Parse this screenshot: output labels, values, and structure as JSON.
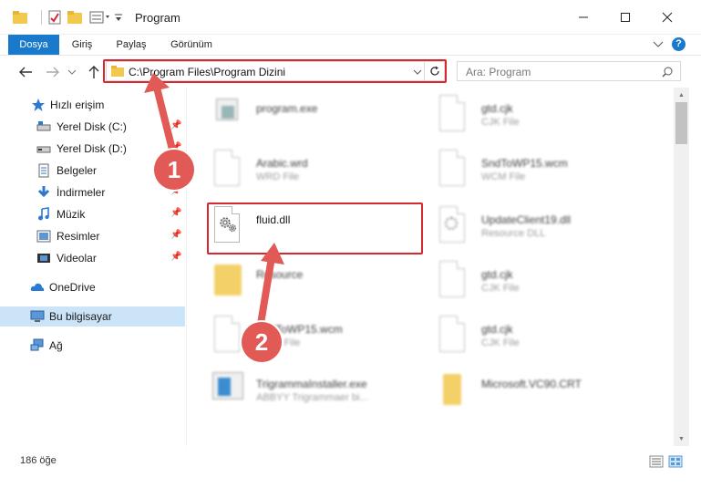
{
  "window": {
    "title": "Program",
    "minimize": "—",
    "maximize": "☐",
    "close": "✕"
  },
  "ribbon": {
    "tabs": [
      "Dosya",
      "Giriş",
      "Paylaş",
      "Görünüm"
    ],
    "help": "?"
  },
  "address": {
    "path": "C:\\Program Files\\Program Dizini",
    "search_placeholder": "Ara: Program"
  },
  "sidebar": {
    "items": [
      {
        "label": "Hızlı erişim",
        "pinned": false
      },
      {
        "label": "Yerel Disk (C:)",
        "pinned": true
      },
      {
        "label": "Yerel Disk (D:)",
        "pinned": true
      },
      {
        "label": "Belgeler",
        "pinned": true
      },
      {
        "label": "İndirmeler",
        "pinned": true
      },
      {
        "label": "Müzik",
        "pinned": true
      },
      {
        "label": "Resimler",
        "pinned": true
      },
      {
        "label": "Videolar",
        "pinned": true
      },
      {
        "label": "OneDrive",
        "pinned": false
      },
      {
        "label": "Bu bilgisayar",
        "pinned": false,
        "selected": true
      },
      {
        "label": "Ağ",
        "pinned": false
      }
    ]
  },
  "files": [
    {
      "name": "program.exe",
      "type": ""
    },
    {
      "name": "gtd.cjk",
      "type": "CJK File"
    },
    {
      "name": "Arabic.wrd",
      "type": "WRD File"
    },
    {
      "name": "SndToWP15.wcm",
      "type": "WCM File"
    },
    {
      "name": "fluid.dll",
      "type": ""
    },
    {
      "name": "UpdateClient19.dll",
      "type": "Resource DLL"
    },
    {
      "name": "Resource",
      "type": ""
    },
    {
      "name": "gtd.cjk",
      "type": "CJK File"
    },
    {
      "name": "SndToWP15.wcm",
      "type": "WCM File"
    },
    {
      "name": "gtd.cjk",
      "type": "CJK File"
    },
    {
      "name": "TrigrammaInstaller.exe",
      "type": "ABBYY Trigrammaer bi..."
    },
    {
      "name": "Microsoft.VC90.CRT",
      "type": ""
    }
  ],
  "status": {
    "count": "186 öğe"
  },
  "callouts": [
    "1",
    "2"
  ],
  "colors": {
    "accent": "#1979ca",
    "highlight": "#d8282f",
    "callout": "#e25a55",
    "selected": "#cce4f7"
  }
}
